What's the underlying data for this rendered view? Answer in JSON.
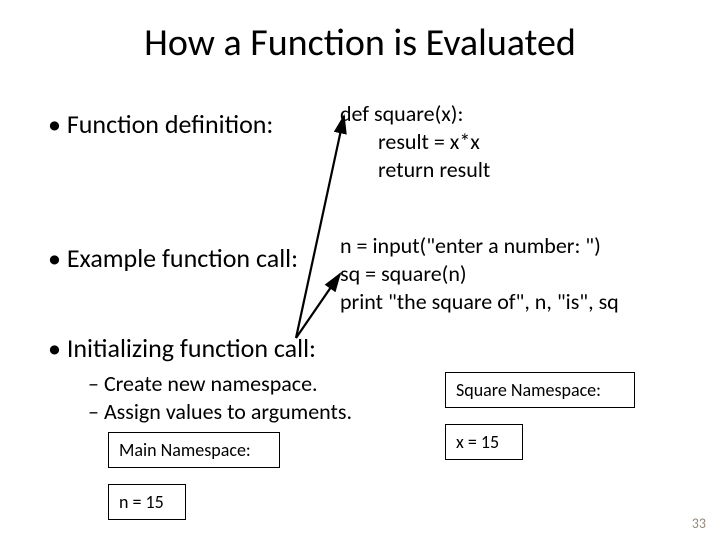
{
  "title": "How a Function is Evaluated",
  "bullets": {
    "def": "Function definition:",
    "call": "Example function call:",
    "init": "Initializing function call:",
    "sub1": "Create new namespace.",
    "sub2": "Assign values to arguments."
  },
  "code": {
    "def1": "def square(x):",
    "def2": "result = x*x",
    "def3": "return result",
    "call1": "n = input(\"enter a number: \")",
    "call2": "sq = square(n)",
    "call3": "print \"the square of\", n, \"is\", sq"
  },
  "boxes": {
    "main_ns": "Main Namespace:",
    "n15": "n = 15",
    "sq_ns": "Square Namespace:",
    "x15": "x = 15"
  },
  "page": "33"
}
